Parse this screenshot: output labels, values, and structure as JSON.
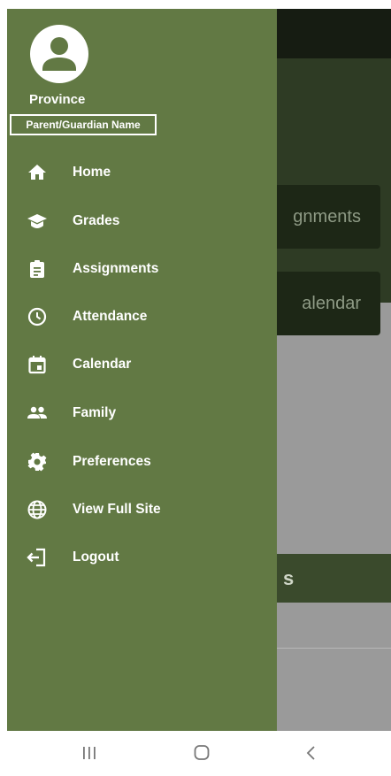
{
  "background_app": {
    "card_1": "gnments",
    "card_2": "alendar",
    "section": "s"
  },
  "drawer": {
    "profile_name": "Province",
    "guardian_name": "Parent/Guardian Name",
    "items": [
      {
        "label": "Home",
        "icon": "home-icon"
      },
      {
        "label": "Grades",
        "icon": "graduation-cap-icon"
      },
      {
        "label": "Assignments",
        "icon": "clipboard-icon"
      },
      {
        "label": "Attendance",
        "icon": "clock-icon"
      },
      {
        "label": "Calendar",
        "icon": "calendar-icon"
      },
      {
        "label": "Family",
        "icon": "people-icon"
      },
      {
        "label": "Preferences",
        "icon": "gear-icon"
      },
      {
        "label": "View Full Site",
        "icon": "globe-icon"
      },
      {
        "label": "Logout",
        "icon": "logout-icon"
      }
    ]
  },
  "navbar": {
    "buttons": [
      "recent-apps",
      "home",
      "back"
    ]
  },
  "colors": {
    "drawer": "#627944",
    "scrim_topbar": "#161c12",
    "scrim_banner": "#2e3b24",
    "scrim_content": "#9a9a9a"
  }
}
